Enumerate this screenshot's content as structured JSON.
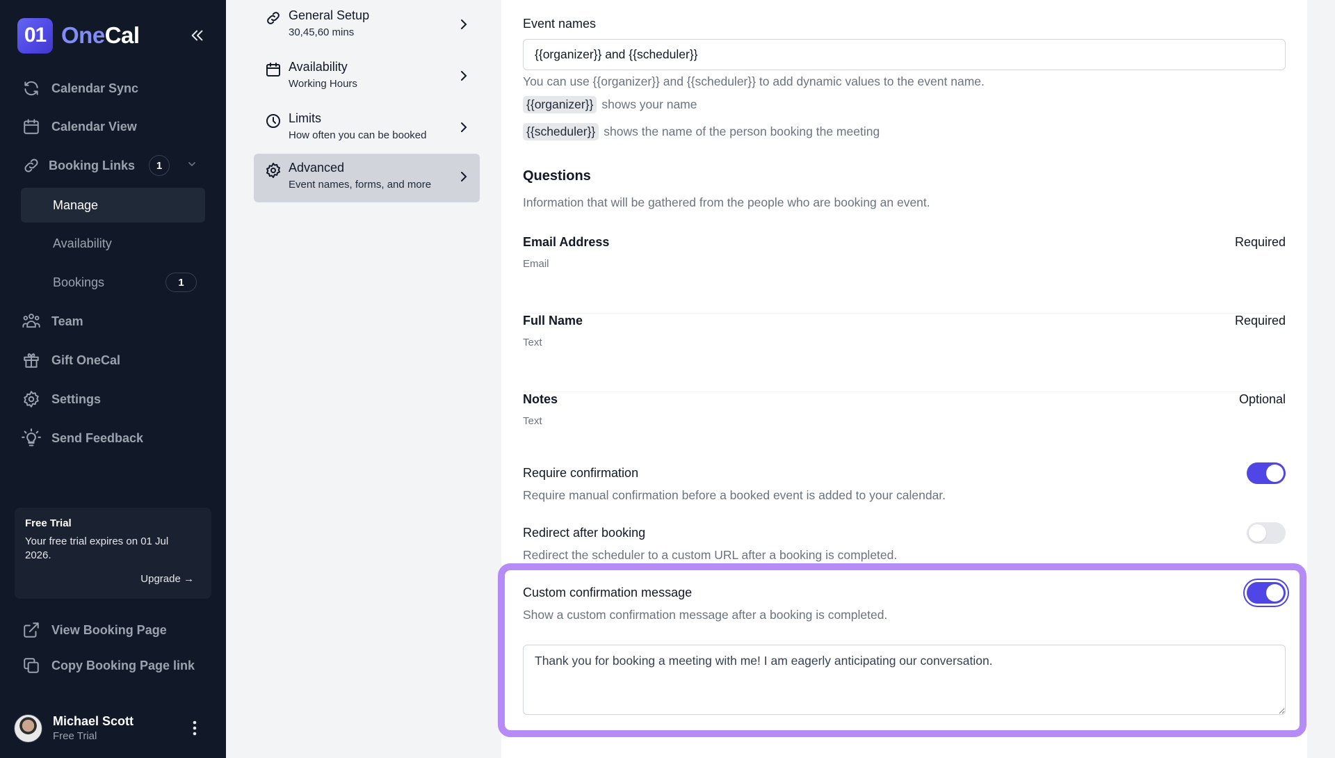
{
  "brand": {
    "name_part1": "One",
    "name_part2": "Cal",
    "logo_mark": "01",
    "accent": "#4f46e5",
    "highlight": "#b58cf7"
  },
  "sidebar": {
    "collapse_icon": "double-chevron-left-icon",
    "items": [
      {
        "label": "Calendar Sync",
        "icon": "sync-icon"
      },
      {
        "label": "Calendar View",
        "icon": "calendar-icon"
      },
      {
        "label": "Booking Links",
        "icon": "link-icon",
        "badge": "1",
        "expanded": true
      },
      {
        "label": "Team",
        "icon": "team-icon"
      },
      {
        "label": "Gift OneCal",
        "icon": "gift-icon"
      },
      {
        "label": "Settings",
        "icon": "gear-icon"
      },
      {
        "label": "Send Feedback",
        "icon": "lightbulb-icon"
      }
    ],
    "sub_items": [
      {
        "label": "Manage",
        "active": true
      },
      {
        "label": "Availability"
      },
      {
        "label": "Bookings",
        "badge": "1"
      }
    ],
    "trial": {
      "title": "Free Trial",
      "text": "Your free trial expires on 01 Jul 2026.",
      "upgrade_label": "Upgrade →"
    },
    "bottom_links": [
      {
        "label": "View Booking Page",
        "icon": "external-link-icon"
      },
      {
        "label": "Copy Booking Page link",
        "icon": "copy-icon"
      }
    ],
    "user": {
      "name": "Michael Scott",
      "plan": "Free Trial"
    }
  },
  "settings_nav": [
    {
      "title": "General Setup",
      "subtitle": "30,45,60 mins",
      "icon": "link-icon"
    },
    {
      "title": "Availability",
      "subtitle": "Working Hours",
      "icon": "calendar-icon"
    },
    {
      "title": "Limits",
      "subtitle": "How often you can be booked",
      "icon": "clock-icon"
    },
    {
      "title": "Advanced",
      "subtitle": "Event names, forms, and more",
      "icon": "gear-icon",
      "active": true
    }
  ],
  "main": {
    "event_names": {
      "label": "Event names",
      "value": "{{organizer}} and {{scheduler}}",
      "help": "You can use {{organizer}} and {{scheduler}} to add dynamic values to the event name.",
      "tokens": [
        {
          "token": "{{organizer}}",
          "desc": "shows your name"
        },
        {
          "token": "{{scheduler}}",
          "desc": "shows the name of the person booking the meeting"
        }
      ]
    },
    "questions": {
      "title": "Questions",
      "subtitle": "Information that will be gathered from the people who are booking an event.",
      "items": [
        {
          "label": "Email Address",
          "type": "Email",
          "requirement": "Required"
        },
        {
          "label": "Full Name",
          "type": "Text",
          "requirement": "Required"
        },
        {
          "label": "Notes",
          "type": "Text",
          "requirement": "Optional"
        }
      ]
    },
    "toggles": [
      {
        "label": "Require confirmation",
        "desc": "Require manual confirmation before a booked event is added to your calendar.",
        "on": true
      },
      {
        "label": "Redirect after booking",
        "desc": "Redirect the scheduler to a custom URL after a booking is completed.",
        "on": false
      },
      {
        "label": "Custom confirmation message",
        "desc": "Show a custom confirmation message after a booking is completed.",
        "on": true
      }
    ],
    "confirmation_message": "Thank you for booking a meeting with me! I am eagerly anticipating our conversation."
  }
}
